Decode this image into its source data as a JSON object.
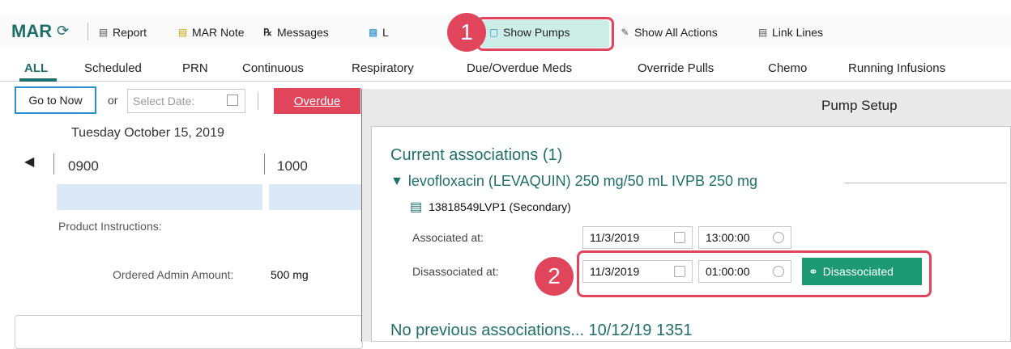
{
  "toolbar": {
    "title": "MAR",
    "items": [
      {
        "label": "Report"
      },
      {
        "label": "MAR Note"
      },
      {
        "label": "Messages"
      },
      {
        "label": "L"
      },
      {
        "label": "Show Pumps"
      },
      {
        "label": "Show All Actions"
      },
      {
        "label": "Link Lines"
      }
    ]
  },
  "tabs": [
    "ALL",
    "Scheduled",
    "PRN",
    "Continuous",
    "Respiratory",
    "Due/Overdue Meds",
    "Override Pulls",
    "Chemo",
    "Running Infusions"
  ],
  "left": {
    "go_to_now": "Go to Now",
    "or": "or",
    "select_date_placeholder": "Select Date:",
    "overdue": "Overdue",
    "date_header": "Tuesday October 15, 2019",
    "times": [
      "0900",
      "1000"
    ],
    "product_instructions": "Product Instructions:",
    "ordered_admin_amount_label": "Ordered Admin Amount:",
    "ordered_admin_amount_value": "500 mg"
  },
  "dialog": {
    "title": "Pump Setup",
    "current_associations": "Current associations (1)",
    "medication": "levofloxacin (LEVAQUIN) 250 mg/50 mL IVPB 250 mg",
    "pump": "13818549LVP1 (Secondary)",
    "associated_label": "Associated at:",
    "associated_date": "11/3/2019",
    "associated_time": "13:00:00",
    "disassociated_label": "Disassociated at:",
    "disassociated_date": "11/3/2019",
    "disassociated_time": "01:00:00",
    "disassociated_button": "Disassociated",
    "footer_partial": "No previous associations... 10/12/19 1351"
  },
  "callouts": [
    "1",
    "2"
  ],
  "colors": {
    "accent": "#1f6f6c",
    "callout": "#e0455b",
    "overdue": "#e0455b",
    "disassociate": "#1e9a72",
    "time_cell": "#dbe9f7"
  }
}
